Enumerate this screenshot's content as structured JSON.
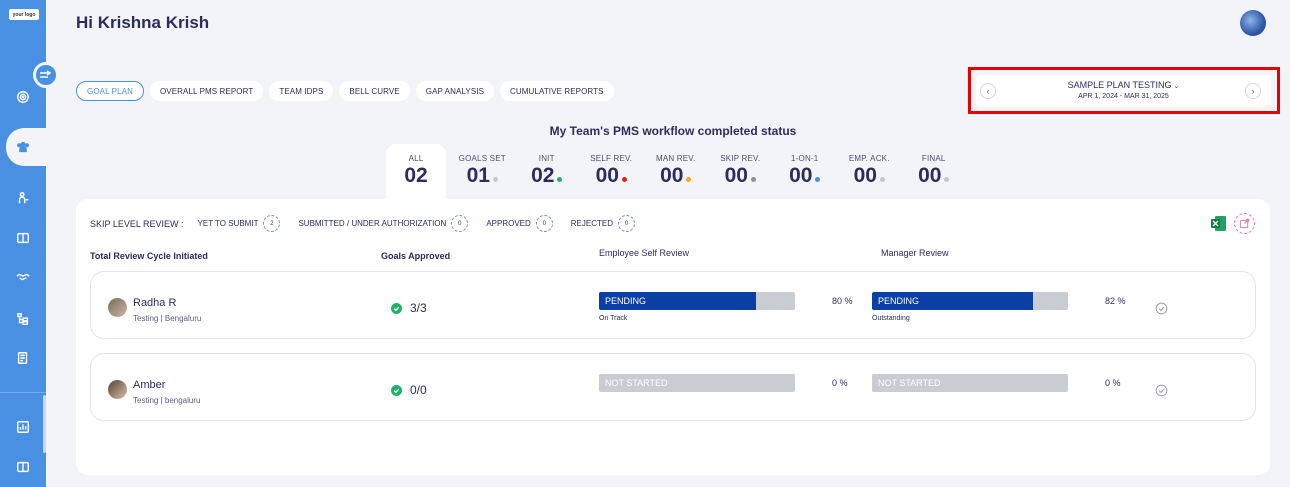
{
  "app": {
    "logo_text": "your logo"
  },
  "greeting": "Hi Krishna Krish",
  "tabs": [
    {
      "label": "GOAL PLAN",
      "active": true
    },
    {
      "label": "OVERALL PMS REPORT",
      "active": false
    },
    {
      "label": "TEAM IDPS",
      "active": false
    },
    {
      "label": "BELL CURVE",
      "active": false
    },
    {
      "label": "GAP ANALYSIS",
      "active": false
    },
    {
      "label": "CUMULATIVE REPORTS",
      "active": false
    }
  ],
  "plan": {
    "title": "SAMPLE PLAN TESTING",
    "dates": "APR 1, 2024 - MAR 31, 2025",
    "prev_glyph": "‹",
    "next_glyph": "›",
    "chevron_glyph": "⌄"
  },
  "workflow_title": "My Team's PMS workflow completed status",
  "statuses": [
    {
      "label": "ALL",
      "value": "02",
      "dot": ""
    },
    {
      "label": "GOALS SET",
      "value": "01",
      "dot": "#c5c7d0"
    },
    {
      "label": "INIT",
      "value": "02",
      "dot": "#1fb26b"
    },
    {
      "label": "SELF REV.",
      "value": "00",
      "dot": "#e0201a"
    },
    {
      "label": "MAN REV.",
      "value": "00",
      "dot": "#f5a623"
    },
    {
      "label": "SKIP REV.",
      "value": "00",
      "dot": "#8a8ea0"
    },
    {
      "label": "1-ON-1",
      "value": "00",
      "dot": "#4a90e2"
    },
    {
      "label": "EMP. ACK.",
      "value": "00",
      "dot": "#c5c7d0"
    },
    {
      "label": "FINAL",
      "value": "00",
      "dot": "#c5c7d0"
    }
  ],
  "skip_level": {
    "label": "SKIP LEVEL REVIEW :",
    "items": [
      {
        "label": "YET TO SUBMIT",
        "count": "2"
      },
      {
        "label": "SUBMITTED / UNDER AUTHORIZATION",
        "count": "0"
      },
      {
        "label": "APPROVED",
        "count": "0"
      },
      {
        "label": "REJECTED",
        "count": "0"
      }
    ]
  },
  "columns": {
    "cycle": "Total Review Cycle Initiated",
    "goals": "Goals Approved",
    "self_review": "Employee Self Review",
    "manager_review": "Manager Review"
  },
  "employees": [
    {
      "name": "Radha R",
      "meta": "Testing | Bengaluru",
      "goals": "3/3",
      "self": {
        "status": "PENDING",
        "progress": 0.8,
        "pct": "80 %",
        "note": "On Track"
      },
      "manager": {
        "status": "PENDING",
        "progress": 0.82,
        "pct": "82 %",
        "note": "Outstanding"
      }
    },
    {
      "name": "Amber",
      "meta": "Testing | bengaluru",
      "goals": "0/0",
      "self": {
        "status": "NOT STARTED",
        "progress": 0,
        "pct": "0 %",
        "note": ""
      },
      "manager": {
        "status": "NOT STARTED",
        "progress": 0,
        "pct": "0 %",
        "note": ""
      }
    }
  ],
  "colors": {
    "brand": "#4a90e2",
    "progress_fill": "#0a3fa3",
    "highlight": "#e60000"
  }
}
